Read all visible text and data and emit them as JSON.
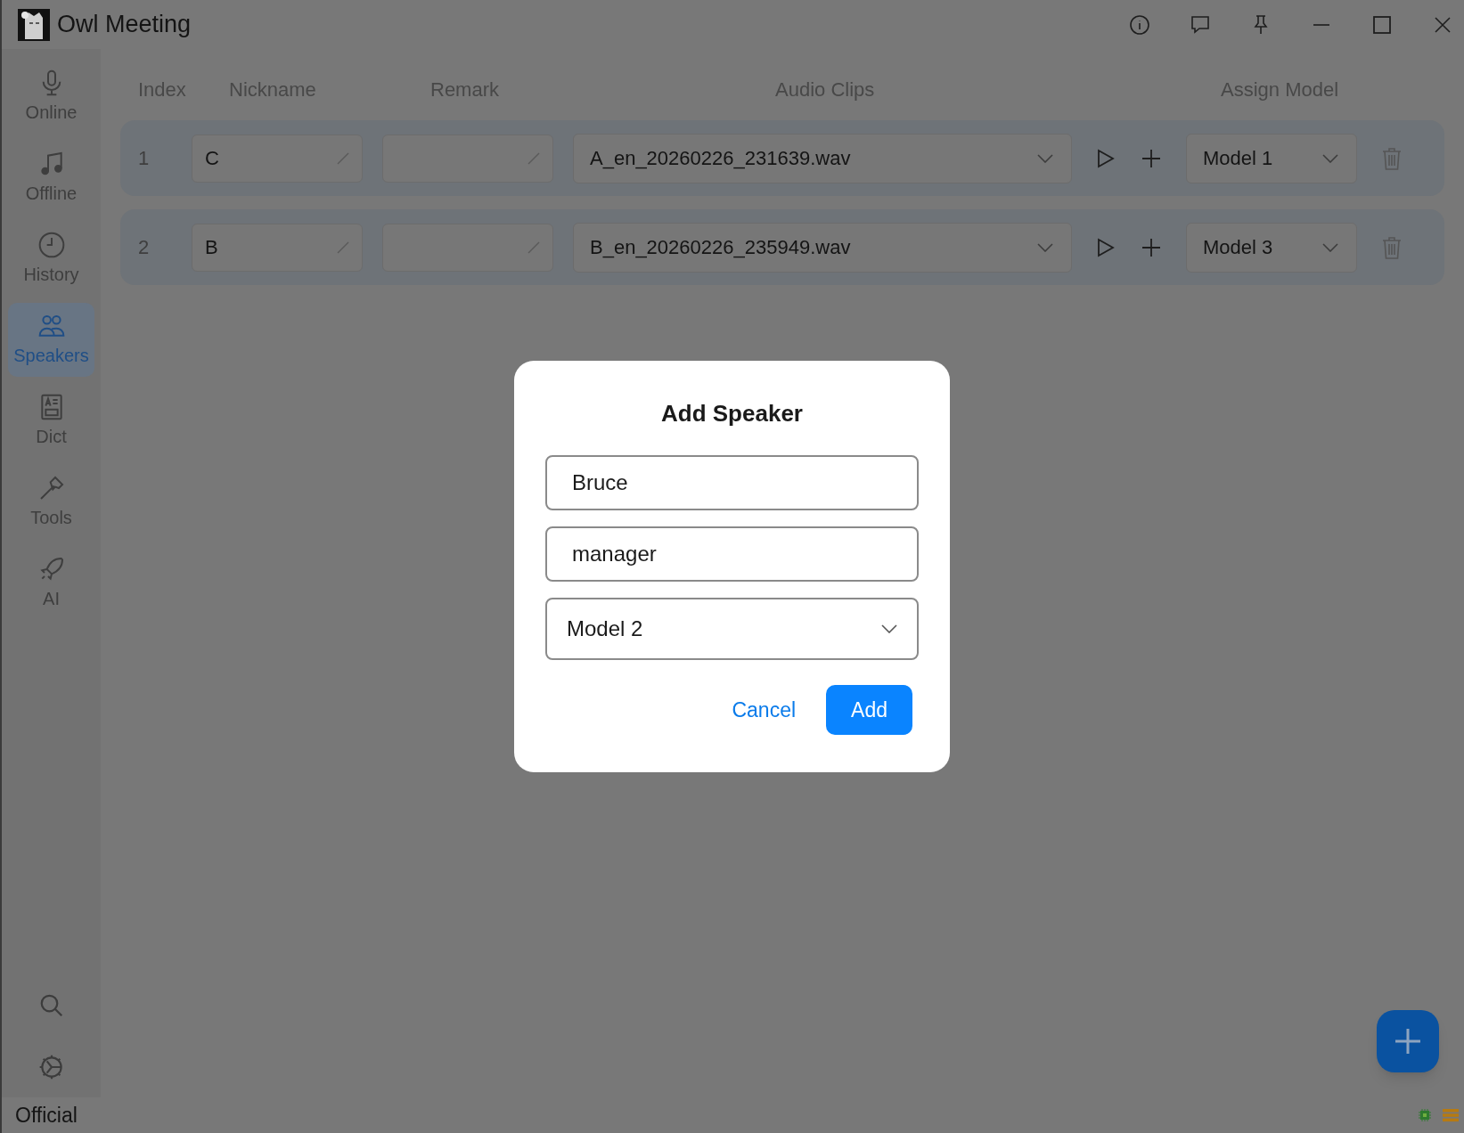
{
  "window": {
    "title": "Owl Meeting"
  },
  "sidebar": {
    "items": [
      {
        "label": "Online",
        "kind": "mic",
        "selected": false
      },
      {
        "label": "Offline",
        "kind": "music",
        "selected": false
      },
      {
        "label": "History",
        "kind": "clock",
        "selected": false
      },
      {
        "label": "Speakers",
        "kind": "people",
        "selected": true
      },
      {
        "label": "Dict",
        "kind": "dict",
        "selected": false
      },
      {
        "label": "Tools",
        "kind": "hammer",
        "selected": false
      },
      {
        "label": "AI",
        "kind": "rocket",
        "selected": false
      }
    ]
  },
  "table": {
    "columns": [
      "Index",
      "Nickname",
      "Remark",
      "Audio Clips",
      "Assign Model"
    ],
    "rows": [
      {
        "index": "1",
        "nickname": "C",
        "remark": "",
        "audio_clip": "A_en_20260226_231639.wav",
        "model": "Model 1"
      },
      {
        "index": "2",
        "nickname": "B",
        "remark": "",
        "audio_clip": "B_en_20260226_235949.wav",
        "model": "Model 3"
      }
    ]
  },
  "dialog": {
    "title": "Add Speaker",
    "nickname": "Bruce",
    "remark": "manager",
    "model": "Model 2",
    "buttons": [
      {
        "label": "Cancel",
        "kind": "text"
      },
      {
        "label": "Add",
        "kind": "primary"
      }
    ]
  },
  "status_bar": {
    "label": "Official"
  }
}
